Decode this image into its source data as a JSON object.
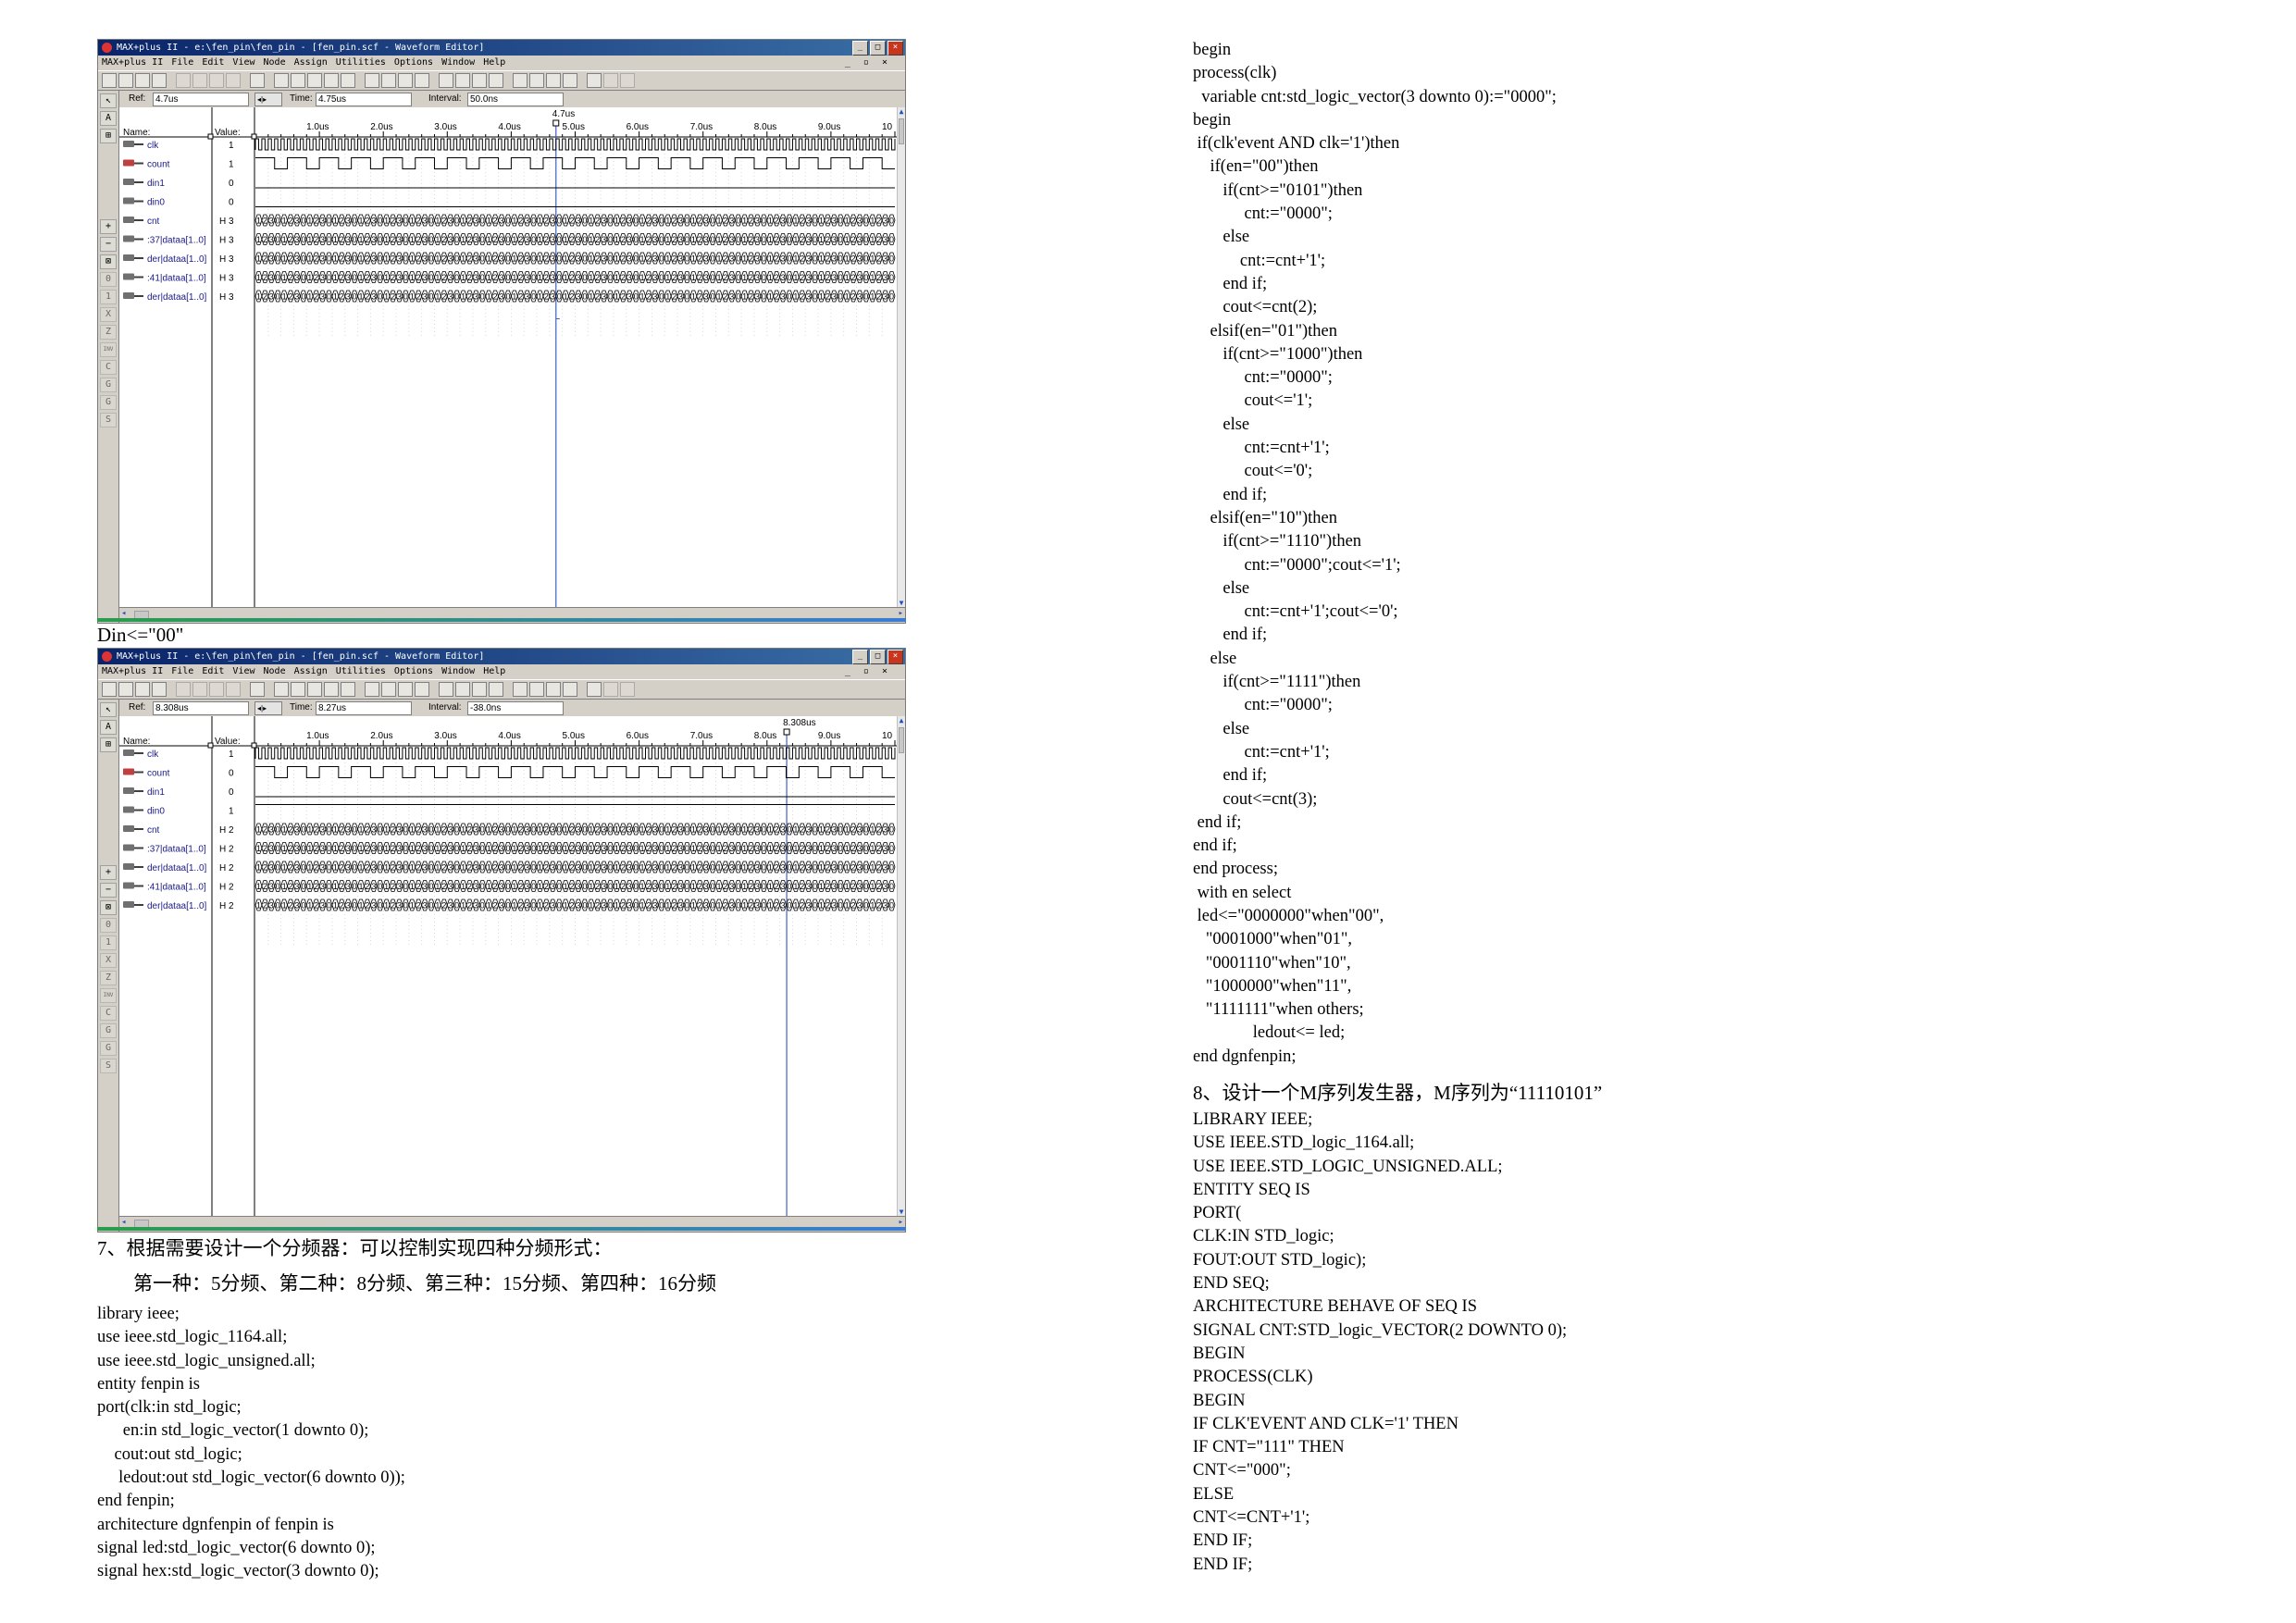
{
  "windows": [
    {
      "title": "MAX+plus II - e:\\fen_pin\\fen_pin - [fen_pin.scf - Waveform Editor]",
      "menu": [
        "MAX+plus II",
        "File",
        "Edit",
        "View",
        "Node",
        "Assign",
        "Utilities",
        "Options",
        "Window",
        "Help"
      ],
      "ref_label": "Ref:",
      "ref_value": "4.7us",
      "time_label": "Time:",
      "time_value": "4.75us",
      "interval_label": "Interval:",
      "interval_value": "50.0ns",
      "cursor_label": "4.7us",
      "name_header": "Name:",
      "value_header": "Value:",
      "ticks": [
        "1.0us",
        "2.0us",
        "3.0us",
        "4.0us",
        "5.0us",
        "6.0us",
        "7.0us",
        "8.0us",
        "9.0us",
        "10"
      ],
      "signals": [
        {
          "name": "clk",
          "value": "1",
          "kind": "clock"
        },
        {
          "name": "count",
          "value": "1",
          "kind": "pulse"
        },
        {
          "name": "din1",
          "value": "0",
          "kind": "low"
        },
        {
          "name": "din0",
          "value": "0",
          "kind": "low"
        },
        {
          "name": "cnt",
          "value": "H 3",
          "kind": "bus"
        },
        {
          "name": ":37|dataa[1..0]",
          "value": "H 3",
          "kind": "bus"
        },
        {
          "name": "der|dataa[1..0]",
          "value": "H 3",
          "kind": "bus"
        },
        {
          "name": ":41|dataa[1..0]",
          "value": "H 3",
          "kind": "bus"
        },
        {
          "name": "der|dataa[1..0]",
          "value": "H 3",
          "kind": "bus"
        }
      ],
      "bus_pattern": [
        "1",
        "2",
        "3",
        "0"
      ]
    },
    {
      "title": "MAX+plus II - e:\\fen_pin\\fen_pin - [fen_pin.scf - Waveform Editor]",
      "menu": [
        "MAX+plus II",
        "File",
        "Edit",
        "View",
        "Node",
        "Assign",
        "Utilities",
        "Options",
        "Window",
        "Help"
      ],
      "ref_label": "Ref:",
      "ref_value": "8.308us",
      "time_label": "Time:",
      "time_value": "8.27us",
      "interval_label": "Interval:",
      "interval_value": "-38.0ns",
      "cursor_label": "8.308us",
      "name_header": "Name:",
      "value_header": "Value:",
      "ticks": [
        "1.0us",
        "2.0us",
        "3.0us",
        "4.0us",
        "5.0us",
        "6.0us",
        "7.0us",
        "8.0us",
        "9.0us",
        "10"
      ],
      "signals": [
        {
          "name": "clk",
          "value": "1",
          "kind": "clock"
        },
        {
          "name": "count",
          "value": "0",
          "kind": "pulse"
        },
        {
          "name": "din1",
          "value": "0",
          "kind": "low"
        },
        {
          "name": "din0",
          "value": "1",
          "kind": "high"
        },
        {
          "name": "cnt",
          "value": "H 2",
          "kind": "bus"
        },
        {
          "name": ":37|dataa[1..0]",
          "value": "H 2",
          "kind": "bus"
        },
        {
          "name": "der|dataa[1..0]",
          "value": "H 2",
          "kind": "bus"
        },
        {
          "name": ":41|dataa[1..0]",
          "value": "H 2",
          "kind": "bus"
        },
        {
          "name": "der|dataa[1..0]",
          "value": "H 2",
          "kind": "bus"
        }
      ],
      "bus_pattern": [
        "1",
        "2",
        "3",
        "0"
      ]
    }
  ],
  "caption_din": "Din<=\"00\"",
  "section7_heading": "7、根据需要设计一个分频器：可以控制实现四种分频形式：",
  "section7_sub": "第一种：5分频、第二种：8分频、第三种：15分频、第四种：16分频",
  "left_code": [
    "library ieee;",
    "use ieee.std_logic_1164.all;",
    "use ieee.std_logic_unsigned.all;",
    "entity fenpin is",
    "port(clk:in std_logic;",
    "      en:in std_logic_vector(1 downto 0);",
    "    cout:out std_logic;",
    "     ledout:out std_logic_vector(6 downto 0));",
    "end fenpin;",
    "architecture dgnfenpin of fenpin is",
    "signal led:std_logic_vector(6 downto 0);",
    "signal hex:std_logic_vector(3 downto 0);"
  ],
  "right_code_a": [
    "begin",
    "process(clk)",
    "  variable cnt:std_logic_vector(3 downto 0):=\"0000\";",
    "begin",
    " if(clk'event AND clk='1')then",
    "    if(en=\"00\")then",
    "       if(cnt>=\"0101\")then",
    "            cnt:=\"0000\";",
    "       else",
    "           cnt:=cnt+'1';",
    "       end if;",
    "       cout<=cnt(2);",
    "    elsif(en=\"01\")then",
    "       if(cnt>=\"1000\")then",
    "            cnt:=\"0000\";",
    "            cout<='1';",
    "       else",
    "            cnt:=cnt+'1';",
    "            cout<='0';",
    "       end if;",
    "    elsif(en=\"10\")then",
    "       if(cnt>=\"1110\")then",
    "            cnt:=\"0000\";cout<='1';",
    "       else",
    "            cnt:=cnt+'1';cout<='0';",
    "       end if;",
    "    else",
    "       if(cnt>=\"1111\")then",
    "            cnt:=\"0000\";",
    "       else",
    "            cnt:=cnt+'1';",
    "       end if;",
    "       cout<=cnt(3);",
    " end if;",
    "end if;",
    "end process;",
    " with en select",
    " led<=\"0000000\"when\"00\",",
    "   \"0001000\"when\"01\",",
    "   \"0001110\"when\"10\",",
    "   \"1000000\"when\"11\",",
    "   \"1111111\"when others;",
    "              ledout<= led;",
    "end dgnfenpin;"
  ],
  "section8_heading": "8、设计一个M序列发生器，M序列为“11110101”",
  "right_code_b": [
    "LIBRARY IEEE;",
    "USE IEEE.STD_logic_1164.all;",
    "USE IEEE.STD_LOGIC_UNSIGNED.ALL;",
    "ENTITY SEQ IS",
    "PORT(",
    "CLK:IN STD_logic;",
    "FOUT:OUT STD_logic);",
    "END SEQ;",
    "ARCHITECTURE BEHAVE OF SEQ IS",
    "SIGNAL CNT:STD_logic_VECTOR(2 DOWNTO 0);",
    "BEGIN",
    "PROCESS(CLK)",
    "BEGIN",
    "IF CLK'EVENT AND CLK='1' THEN",
    "IF CNT=\"111\" THEN",
    "CNT<=\"000\";",
    "ELSE",
    "CNT<=CNT+'1';",
    "END IF;",
    "END IF;"
  ]
}
